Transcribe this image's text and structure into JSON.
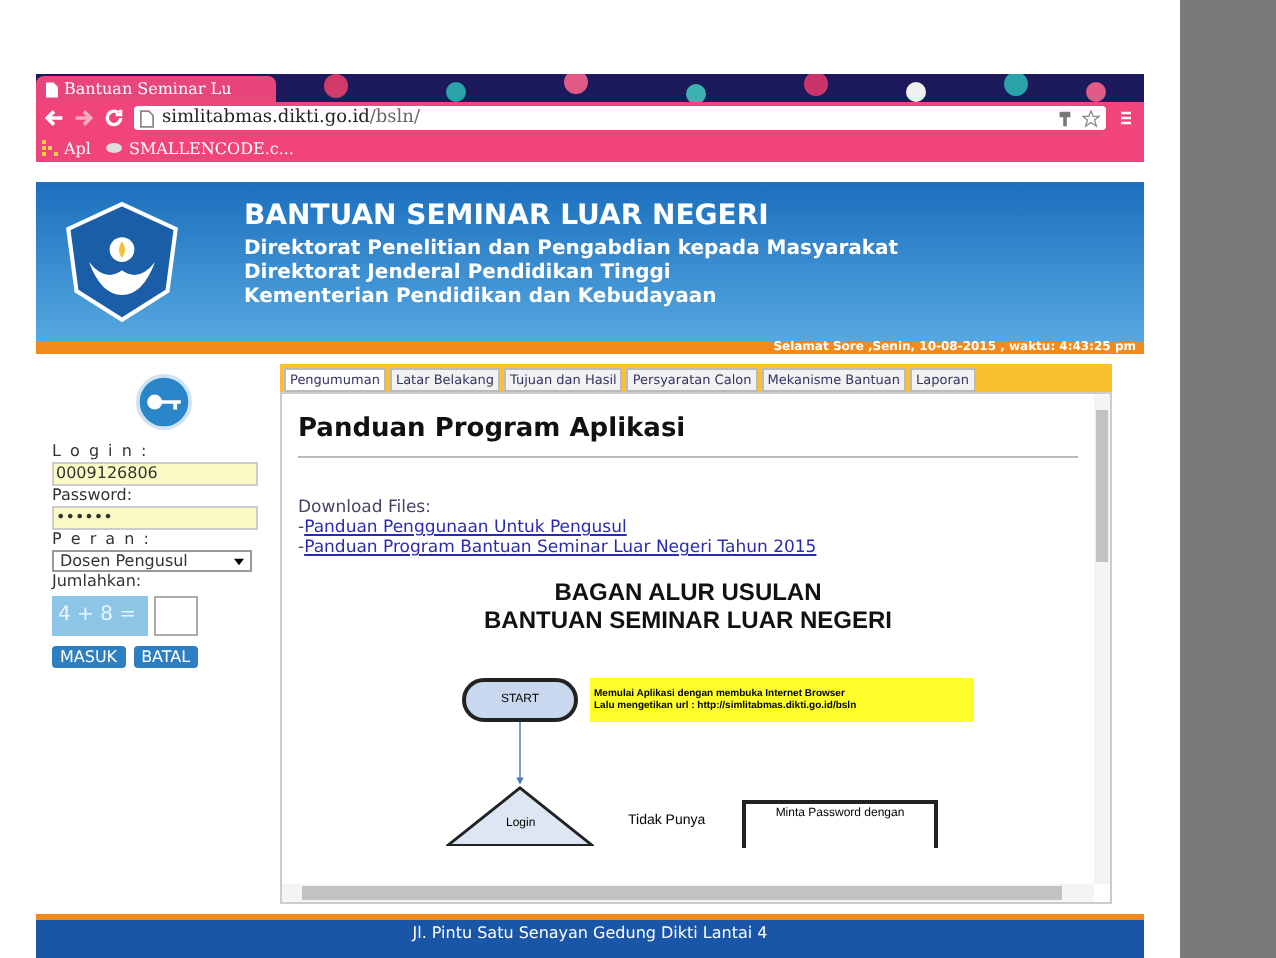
{
  "browser": {
    "tab_title": "Bantuan Seminar Lu",
    "url_host": "simlitabmas.dikti.go.id",
    "url_path": "/bsln/",
    "bookmarks": [
      "Apl",
      "SMALLENCODE.c..."
    ]
  },
  "header": {
    "title": "BANTUAN SEMINAR LUAR NEGERI",
    "lines": [
      "Direktorat Penelitian dan Pengabdian kepada Masyarakat",
      "Direktorat Jenderal Pendidikan Tinggi",
      "Kementerian Pendidikan dan Kebudayaan"
    ],
    "greeting": "Selamat Sore ,Senin, 10-08-2015 , waktu: 4:43:25 pm"
  },
  "login": {
    "login_label": "L o g i n :",
    "login_value": "0009126806",
    "password_label": "Password:",
    "password_value": "••••••",
    "role_label": "P e r a n :",
    "role_value": "Dosen Pengusul",
    "sum_label": "Jumlahkan:",
    "captcha": "4 + 8 =",
    "buttons": [
      "MASUK",
      "BATAL"
    ]
  },
  "tabs": [
    {
      "label": "Pengumuman",
      "selected": true
    },
    {
      "label": "Latar Belakang",
      "selected": false
    },
    {
      "label": "Tujuan dan Hasil",
      "selected": false
    },
    {
      "label": "Persyaratan Calon",
      "selected": false
    },
    {
      "label": "Mekanisme Bantuan",
      "selected": false
    },
    {
      "label": "Laporan",
      "selected": false
    }
  ],
  "content": {
    "heading": "Panduan Program Aplikasi",
    "download_label": "Download Files:",
    "links": [
      {
        "prefix": "-",
        "text": "Panduan Penggunaan Untuk Pengusul"
      },
      {
        "prefix": "-",
        "text": "Panduan Program Bantuan Seminar Luar Negeri Tahun 2015"
      }
    ],
    "chart_title": [
      "BAGAN ALUR USULAN",
      "BANTUAN SEMINAR LUAR NEGERI"
    ],
    "flow": {
      "start": "START",
      "note": [
        "Memulai Aplikasi dengan membuka Internet Browser",
        "Lalu mengetikan url : http://simlitabmas.dikti.go.id/bsln"
      ],
      "decision": "Login",
      "no_label": "Tidak Punya",
      "request": "Minta Password dengan"
    }
  },
  "footer": {
    "address": "Jl. Pintu Satu Senayan Gedung Dikti Lantai 4"
  }
}
